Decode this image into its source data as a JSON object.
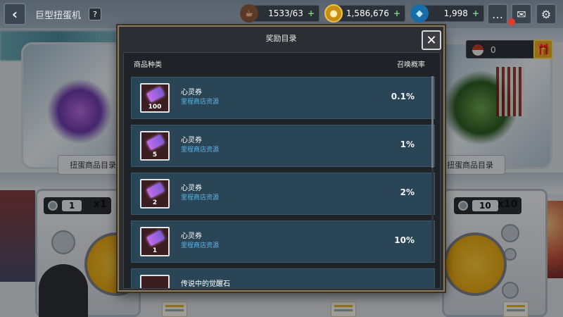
{
  "header": {
    "title": "巨型扭蛋机",
    "back_icon": "back-arrow-icon",
    "help_label": "?"
  },
  "resources": {
    "stamina": {
      "value": "1533/63",
      "icon": "coffee-cup-icon"
    },
    "gold": {
      "value": "1,586,676",
      "icon": "gold-coin-icon"
    },
    "gems": {
      "value": "1,998",
      "icon": "diamond-icon"
    },
    "plus_label": "+",
    "ticket": {
      "value": "0"
    }
  },
  "machines": {
    "left_catalog_label": "扭蛋商品目录",
    "right_catalog_label": "扭蛋商品目录",
    "left_count": "1",
    "left_multiplier": "x1",
    "right_count": "10",
    "right_multiplier": "x10"
  },
  "modal": {
    "title": "奖励目录",
    "close_label": "✕",
    "col_item_type": "商品种类",
    "col_rate": "召唤概率",
    "rows": [
      {
        "name": "心灵券",
        "source": "里程商店资源",
        "qty": "100",
        "rate": "0.1%"
      },
      {
        "name": "心灵券",
        "source": "里程商店资源",
        "qty": "5",
        "rate": "1%"
      },
      {
        "name": "心灵券",
        "source": "里程商店资源",
        "qty": "2",
        "rate": "2%"
      },
      {
        "name": "心灵券",
        "source": "里程商店资源",
        "qty": "1",
        "rate": "10%"
      },
      {
        "name": "传说中的觉醒石",
        "source": "",
        "qty": "",
        "rate": ""
      }
    ]
  },
  "colors": {
    "row_bg": "#2a4656",
    "source_text": "#5fb2e6",
    "modal_border": "#8c7a5a",
    "gift_button": "#e5a81d"
  }
}
